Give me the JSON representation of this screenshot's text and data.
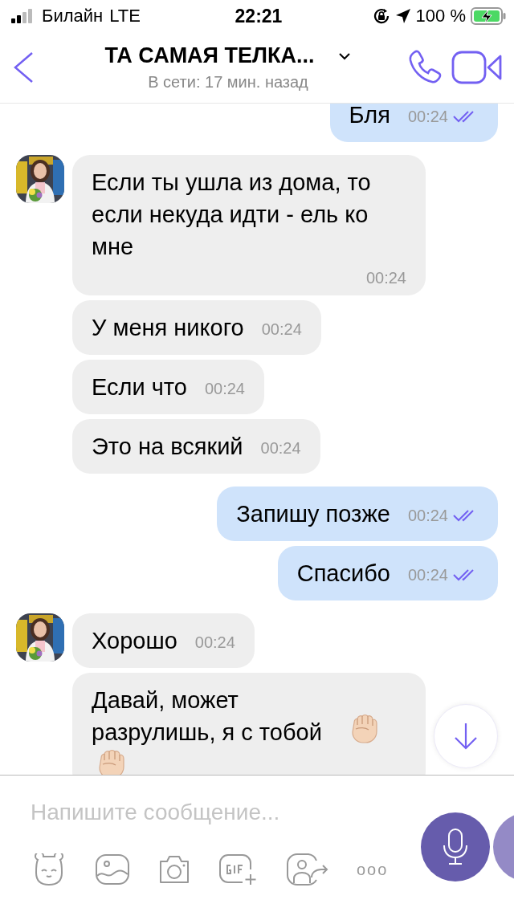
{
  "status_bar": {
    "carrier": "Билайн",
    "network": "LTE",
    "time": "22:21",
    "battery": "100 %"
  },
  "header": {
    "title": "ТА САМАЯ ТЕЛКА...",
    "subtitle": "В сети: 17 мин. назад"
  },
  "messages": [
    {
      "kind": "out",
      "text": "Бля",
      "time": "00:24",
      "avatar": false
    },
    {
      "kind": "in",
      "text": "Если ты ушла из дома, то если некуда идти - ель ко мне",
      "time": "00:24",
      "avatar": true
    },
    {
      "kind": "in",
      "text": "У меня никого",
      "time": "00:24",
      "avatar": false
    },
    {
      "kind": "in",
      "text": "Если что",
      "time": "00:24",
      "avatar": false
    },
    {
      "kind": "in",
      "text": "Это на всякий",
      "time": "00:24",
      "avatar": false
    },
    {
      "kind": "out",
      "text": "Запишу позже",
      "time": "00:24",
      "avatar": false
    },
    {
      "kind": "out",
      "text": "Спасибо",
      "time": "00:24",
      "avatar": false
    },
    {
      "kind": "in",
      "text": "Хорошо",
      "time": "00:24",
      "avatar": true
    },
    {
      "kind": "in",
      "text": "Давай, может разрулишь, я с тобой",
      "emojis": [
        {
          "kind": "fist"
        },
        {
          "kind": "fist"
        }
      ],
      "avatar": false
    }
  ],
  "composer": {
    "placeholder": "Напишите сообщение...",
    "more": "ooo"
  }
}
